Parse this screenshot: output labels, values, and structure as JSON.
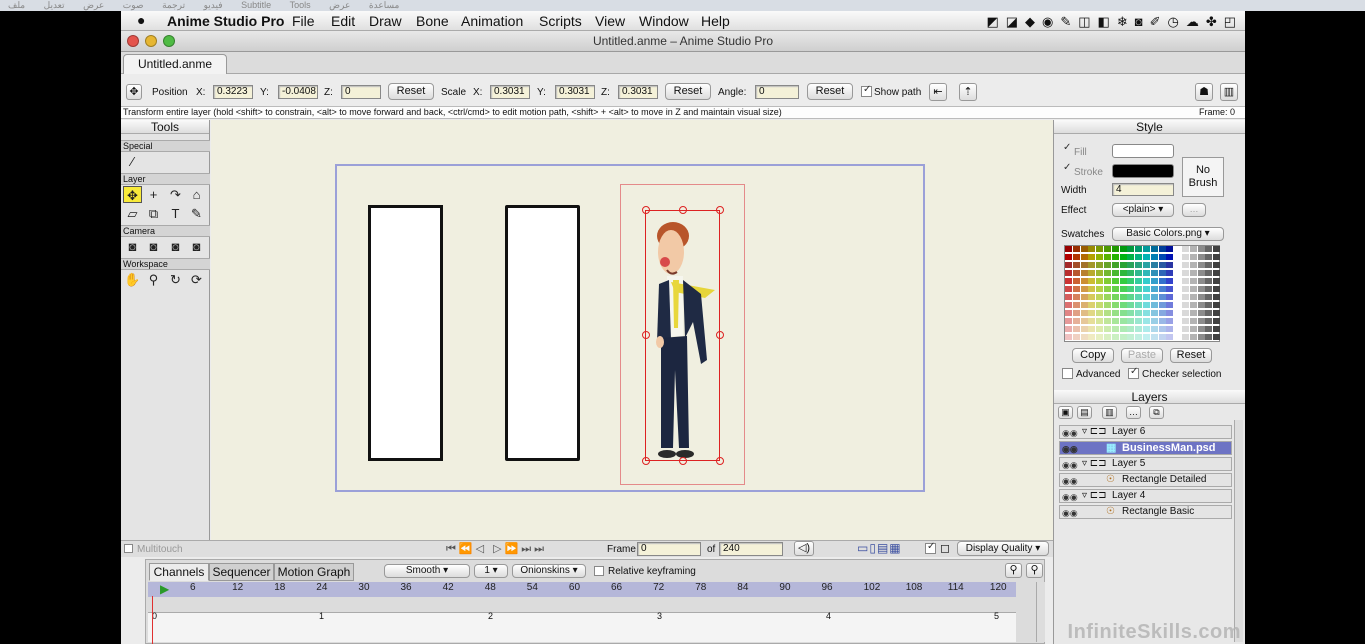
{
  "host_menu": [
    "ملف",
    "تعديل",
    "عرض",
    "صوت",
    "ترجمة",
    "فيديو",
    "Subtitle",
    "Tools",
    "عرض",
    "مساعدة"
  ],
  "app": {
    "name": "Anime Studio Pro",
    "menus": [
      "File",
      "Edit",
      "Draw",
      "Bone",
      "Animation",
      "Scripts",
      "View",
      "Window",
      "Help"
    ],
    "window_title": "Untitled.anme – Anime Studio Pro",
    "doc_tab": "Untitled.anme"
  },
  "toolopts": {
    "position_label": "Position",
    "x_label": "X:",
    "x_value": "0.3223",
    "y_label": "Y:",
    "y_value": "-0.0408",
    "z_label": "Z:",
    "z_value": "0",
    "reset_label": "Reset",
    "scale_label": "Scale",
    "sx_value": "0.3031",
    "sy_value": "0.3031",
    "sz_value": "0.3031",
    "angle_label": "Angle:",
    "angle_value": "0",
    "show_path_label": "Show path"
  },
  "hint": "Transform entire layer (hold <shift> to constrain, <alt> to move forward and back, <ctrl/cmd> to edit motion path, <shift> + <alt> to move in Z and maintain visual size)",
  "frame_indicator": "Frame: 0",
  "tools": {
    "title": "Tools",
    "sections": {
      "special": "Special",
      "layer": "Layer",
      "camera": "Camera",
      "workspace": "Workspace"
    }
  },
  "style": {
    "title": "Style",
    "fill_label": "Fill",
    "stroke_label": "Stroke",
    "no_brush": [
      "No",
      "Brush"
    ],
    "width_label": "Width",
    "width_value": "4",
    "effect_label": "Effect",
    "effect_value": "<plain>",
    "swatches_label": "Swatches",
    "swatches_value": "Basic Colors.png",
    "copy": "Copy",
    "paste": "Paste",
    "reset": "Reset",
    "advanced": "Advanced",
    "checker": "Checker selection"
  },
  "layers": {
    "title": "Layers",
    "rows": [
      {
        "name": "Layer 6",
        "type": "group"
      },
      {
        "name": "BusinessMan.psd",
        "type": "image"
      },
      {
        "name": "Layer 5",
        "type": "group"
      },
      {
        "name": "Rectangle Detailed",
        "type": "bone"
      },
      {
        "name": "Layer 4",
        "type": "group"
      },
      {
        "name": "Rectangle Basic",
        "type": "bone"
      }
    ]
  },
  "navbar": {
    "multitouch": "Multitouch",
    "frame_label": "Frame",
    "frame_value": "0",
    "of_label": "of",
    "of_value": "240",
    "display_quality": "Display Quality"
  },
  "timeline": {
    "tabs": [
      "Channels",
      "Sequencer",
      "Motion Graph"
    ],
    "interp": "Smooth",
    "step": "1",
    "onionskins": "Onionskins",
    "relative": "Relative keyframing",
    "ruler_ticks": [
      "6",
      "12",
      "18",
      "24",
      "30",
      "36",
      "42",
      "48",
      "54",
      "60",
      "66",
      "72",
      "78",
      "84",
      "90",
      "96",
      "102",
      "108",
      "114",
      "120"
    ],
    "lower_ticks": [
      "0",
      "1",
      "2",
      "3",
      "4",
      "5"
    ]
  },
  "watermark": "InfiniteSkills.com",
  "colors": {
    "accent": "#6d73c4",
    "canvas": "#f0efe0",
    "frame": "#9ba0d8",
    "selection": "#d22222"
  }
}
